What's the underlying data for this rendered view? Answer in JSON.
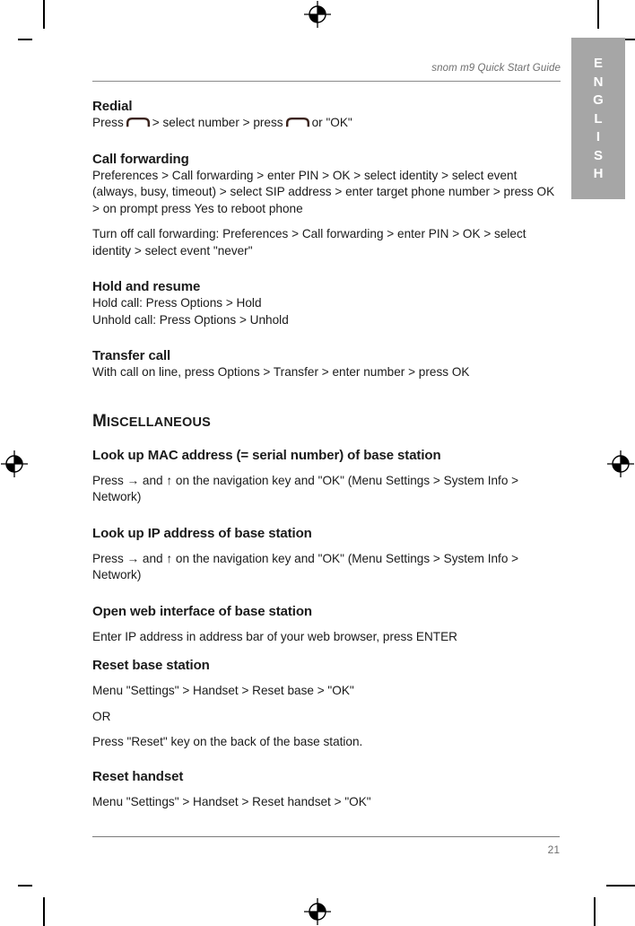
{
  "page": {
    "header_title": "snom m9 Quick Start Guide",
    "page_number": "21",
    "language_tab": "ENGLISH",
    "language_tab_letters": [
      "E",
      "N",
      "G",
      "L",
      "I",
      "S",
      "H"
    ],
    "tab_color": "#a6a6a6",
    "rule_color": "#8a8a8a",
    "handset_icon_color": "#3a231c"
  },
  "sections": {
    "redial": {
      "title": "Redial",
      "line_pre": "Press",
      "line_mid": "> select number  > press",
      "line_post": "or \"OK\""
    },
    "call_forwarding": {
      "title": "Call forwarding",
      "paragraph_1": "Preferences > Call forwarding > enter PIN > OK > select identity > select event (always, busy, timeout) > select SIP address > enter target phone number > press OK > on prompt press Yes to reboot phone",
      "paragraph_2": "Turn off call forwarding:  Preferences > Call forwarding > enter PIN > OK > select identity > select event \"never\""
    },
    "hold_and_resume": {
      "title": "Hold and resume",
      "line_1": "Hold call:  Press Options > Hold",
      "line_2": "Unhold call:  Press Options > Unhold"
    },
    "transfer_call": {
      "title": "Transfer call",
      "line_1": "With call on line, press Options > Transfer > enter number > press OK"
    },
    "miscellaneous": {
      "title_first": "M",
      "title_rest": "ISCELLANEOUS"
    },
    "mac_address": {
      "title": "Look up MAC address (= serial number) of base station",
      "line_1": "Press → and ↑ on the navigation key and \"OK\" (Menu Settings > System Info > Network)"
    },
    "ip_address": {
      "title": "Look up IP address of base station",
      "line_1": "Press → and ↑ on the navigation key and \"OK\" (Menu Settings > System Info > Network)"
    },
    "web_interface": {
      "title": "Open web interface of base station",
      "line_1": "Enter IP address in address bar of your web browser, press ENTER"
    },
    "reset_base": {
      "title": "Reset base station",
      "line_1": "Menu \"Settings\"  >  Handset  >  Reset base >  \"OK\"",
      "line_2": "OR",
      "line_3": "Press \"Reset\" key on the back of the base station."
    },
    "reset_handset": {
      "title": "Reset handset",
      "line_1": "Menu \"Settings\"  >  Handset  >  Reset handset >  \"OK\""
    }
  }
}
